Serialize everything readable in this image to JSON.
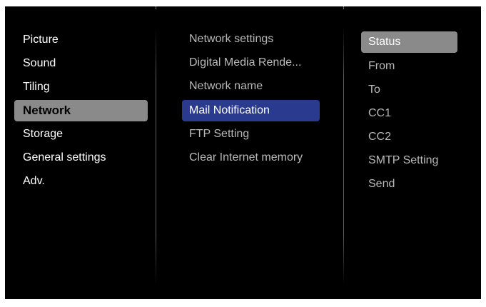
{
  "menu": {
    "main_items": [
      {
        "label": "Picture"
      },
      {
        "label": "Sound"
      },
      {
        "label": "Tiling"
      },
      {
        "label": "Network",
        "selected": true
      },
      {
        "label": "Storage"
      },
      {
        "label": "General settings"
      },
      {
        "label": "Adv."
      }
    ],
    "network_items": [
      {
        "label": "Network settings"
      },
      {
        "label": "Digital Media Rende..."
      },
      {
        "label": "Network name"
      },
      {
        "label": "Mail Notification",
        "highlighted": true
      },
      {
        "label": "FTP Setting"
      },
      {
        "label": "Clear Internet memory"
      }
    ],
    "mail_items": [
      {
        "label": "Status",
        "focused": true
      },
      {
        "label": "From"
      },
      {
        "label": "To"
      },
      {
        "label": "CC1"
      },
      {
        "label": "CC2"
      },
      {
        "label": "SMTP Setting"
      },
      {
        "label": "Send"
      }
    ]
  },
  "colors": {
    "background": "#000000",
    "main_selected": "#8a8a8a",
    "sub_highlight": "#2a3a8f",
    "option_focus": "#8a8a8a",
    "inactive_text": "#b9b9b9",
    "active_text": "#ffffff"
  }
}
